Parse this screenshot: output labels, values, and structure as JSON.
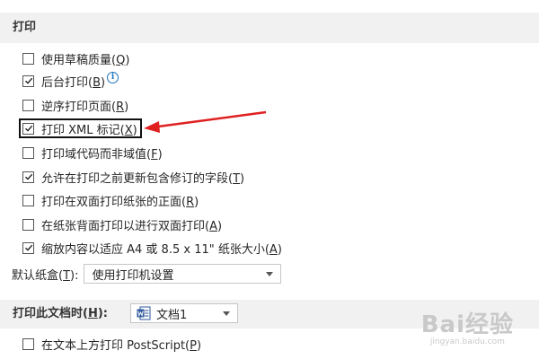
{
  "sections": {
    "print_title": "打印",
    "doc_title_before": "打印此文档时(",
    "doc_title_key": "H",
    "doc_title_after": "):"
  },
  "options": [
    {
      "before": "使用草稿质量(",
      "key": "Q",
      "after": ")",
      "checked": false
    },
    {
      "before": "后台打印(",
      "key": "B",
      "after": ")",
      "checked": true,
      "info": "i"
    },
    {
      "before": "逆序打印页面(",
      "key": "R",
      "after": ")",
      "checked": false
    },
    {
      "before": "打印 XML 标记(",
      "key": "X",
      "after": ")",
      "checked": true
    },
    {
      "before": "打印域代码而非域值(",
      "key": "F",
      "after": ")",
      "checked": false
    },
    {
      "before": "允许在打印之前更新包含修订的字段(",
      "key": "T",
      "after": ")",
      "checked": true
    },
    {
      "before": "打印在双面打印纸张的正面(",
      "key": "R",
      "after": ")",
      "checked": false
    },
    {
      "before": "在纸张背面打印以进行双面打印(",
      "key": "A",
      "after": ")",
      "checked": false
    },
    {
      "before": "缩放内容以适应 A4 或 8.5 x 11\" 纸张大小(",
      "key": "A",
      "after": ")",
      "checked": true
    }
  ],
  "tray": {
    "label_before": "默认纸盒(",
    "label_key": "T",
    "label_after": "):",
    "value": "使用打印机设置"
  },
  "doc_select": {
    "value": "文档1"
  },
  "doc_options": [
    {
      "before": "在文本上方打印 PostScript(",
      "key": "P",
      "after": ")",
      "checked": false
    }
  ],
  "watermark": {
    "main": "Bai经验",
    "sub": "jingyan.baidu.com"
  },
  "colors": {
    "annotation_arrow": "#e02020",
    "header_bg": "#f1f1f1",
    "info_blue": "#1e73be",
    "word_blue": "#2b579a"
  },
  "icons": {
    "checkmark": "checkmark-icon",
    "dropdown": "chevron-down-icon",
    "word_doc": "word-document-icon",
    "info": "info-icon"
  }
}
